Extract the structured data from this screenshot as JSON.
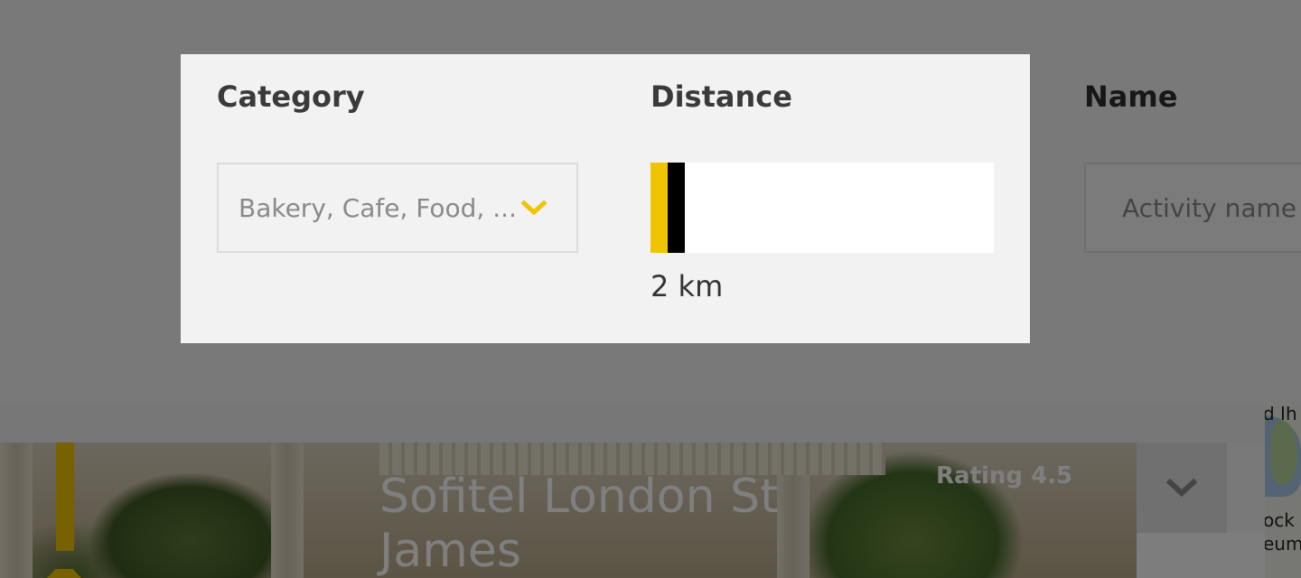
{
  "filters": {
    "category": {
      "heading": "Category",
      "selected_value": "Bakery, Cafe, Food, ...",
      "dropdown_icon": "chevron-down-icon"
    },
    "distance": {
      "heading": "Distance",
      "value_label": "2 km",
      "slider_level_fraction": 0.05
    },
    "name": {
      "heading": "Name",
      "placeholder": "Activity name"
    }
  },
  "result_card": {
    "title": "Sofitel London St James",
    "rating": "Rating 4.5",
    "expand_icon": "chevron-down-icon"
  },
  "map": {
    "label_lines": [
      "d Ih",
      "ock",
      "eum"
    ]
  },
  "colors": {
    "accent": "#f0c400",
    "slider_handle": "#000000",
    "overlay": "rgba(0,0,0,0.5)",
    "modal_background": "#f2f2f2"
  }
}
